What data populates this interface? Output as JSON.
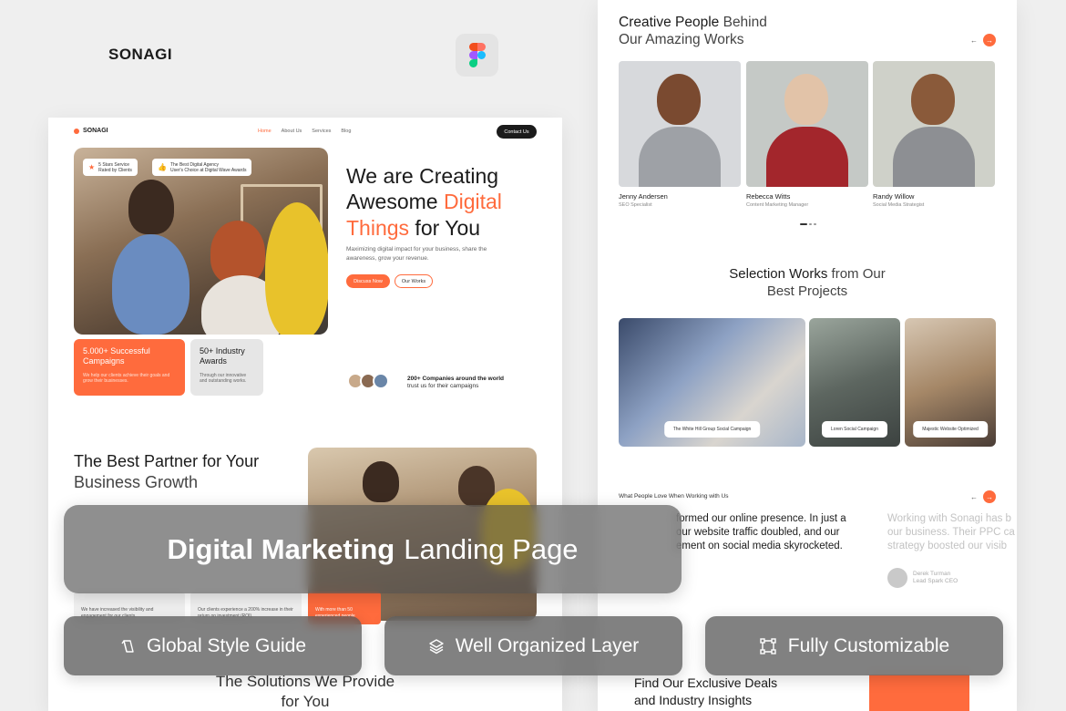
{
  "brand": "SONAGI",
  "figma_icon": "figma-logo-icon",
  "left_mock": {
    "nav": {
      "logo": "SONAGI",
      "links": [
        "Home",
        "About Us",
        "Services",
        "Blog"
      ],
      "contact": "Contact Us"
    },
    "hero": {
      "tag1_line1": "5 Stars Service",
      "tag1_line2": "Rated by Clients",
      "tag2_line1": "The Best Digital Agency",
      "tag2_line2": "User's Choice at Digital Wave Awards",
      "title_1": "We are Creating",
      "title_2a": "Awesome ",
      "title_2b": "Digital",
      "title_3a": "Things",
      "title_3b": " for You",
      "subtitle": "Maximizing digital impact for your business, share the awareness, grow your revenue.",
      "btn_primary": "Discuss Now",
      "btn_secondary": "Our Works",
      "stat1_big": "5.000+ Successful Campaigns",
      "stat1_small": "We help our clients achieve their goals and grow their businesses.",
      "stat2_big": "50+ Industry Awards",
      "stat2_small": "Through our innovative and outstanding works.",
      "trust_bold": "200+ Companies around the world",
      "trust_rest": "trust us for their campaigns"
    },
    "partner": {
      "line1": "The Best Partner for Your",
      "line2": "Business Growth"
    },
    "cards": {
      "c1": "We have increased the visibility and engagement for our clients.",
      "c2": "Our clients experience a 200% increase in their return on investment (ROI).",
      "c3": "With more than 50 experienced people"
    },
    "solutions_1": "The Solutions We Provide",
    "solutions_2": "for You"
  },
  "right_mock": {
    "team_title_bold": "Creative People",
    "team_title_rest": " Behind",
    "team_title_2": "Our Amazing Works",
    "team": [
      {
        "name": "Jenny Andersen",
        "role": "SEO Specialist"
      },
      {
        "name": "Rebecca Witts",
        "role": "Content Marketing Manager"
      },
      {
        "name": "Randy Willow",
        "role": "Social Media Strategist"
      }
    ],
    "works_title_bold": "Selection Works",
    "works_title_rest": " from Our",
    "works_title_2": "Best Projects",
    "works": [
      "The White Hill Group Social Campaign",
      "Loren Social Campaign",
      "Majestic Website Optimized"
    ],
    "testimonials_label": "What People Love When Working with Us",
    "quote_main": "formed our online presence. In just a\nour website traffic doubled, and our\nement on social media skyrocketed.",
    "quote_faded": "Working with Sonagi has b\nour business. Their PPC ca\nstrategy boosted our visib",
    "reviewer_name": "Derek Turman",
    "reviewer_role": "Lead Spark CEO",
    "deals_1": "Find Our Exclusive Deals",
    "deals_2": "and Industry Insights"
  },
  "overlay": {
    "banner_bold": "Digital Marketing",
    "banner_rest": "Landing Page",
    "pills": [
      "Global Style Guide",
      "Well Organized Layer",
      "Fully Customizable"
    ]
  },
  "colors": {
    "accent": "#ff6b3d",
    "dark": "#1b1b1b",
    "page_bg": "#efefef"
  }
}
